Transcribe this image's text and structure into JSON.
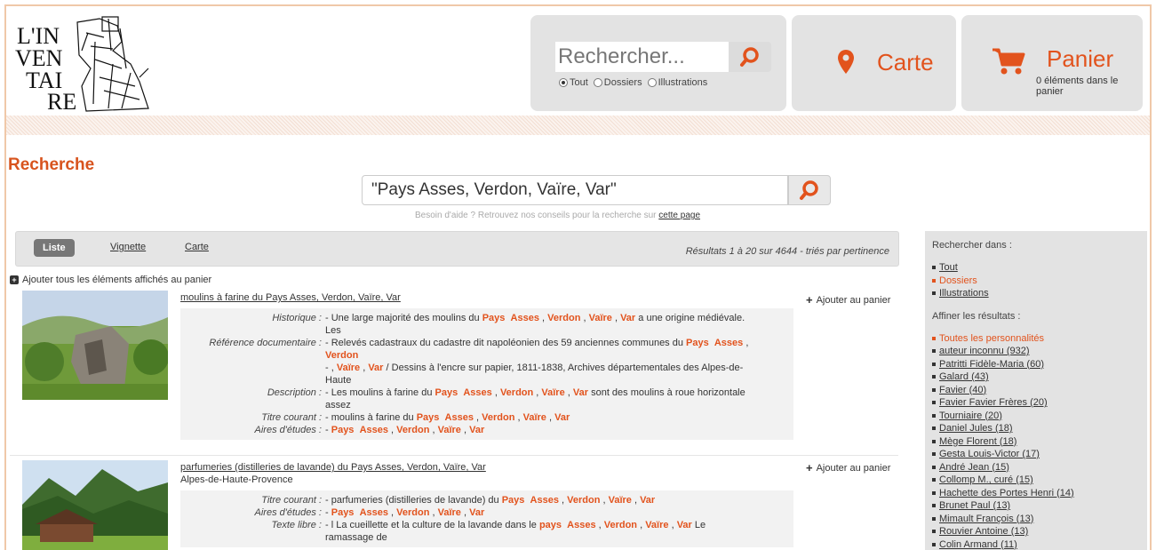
{
  "header": {
    "logo_text": "L'INVENTAIRE",
    "search_placeholder": "Rechercher...",
    "radio_options": [
      "Tout",
      "Dossiers",
      "Illustrations"
    ],
    "radio_selected": "Tout",
    "map_label": "Carte",
    "cart_label": "Panier",
    "cart_count": "0 éléments dans le panier"
  },
  "page_title": "Recherche",
  "main_search": {
    "value": "\"Pays Asses, Verdon, Vaïre, Var\"",
    "help_text": "Besoin d'aide ? Retrouvez nos conseils pour la recherche sur ",
    "help_link": "cette page"
  },
  "toolbar": {
    "tabs": [
      "Liste",
      "Vignette",
      "Carte"
    ],
    "results_text": "Résultats 1 à 20 sur 4644 - triés par pertinence"
  },
  "add_all_label": "Ajouter tous les éléments affichés au panier",
  "add_to_cart_label": "Ajouter au panier",
  "results": [
    {
      "title": "moulins à farine du Pays Asses, Verdon, Vaïre, Var",
      "subtitle": "",
      "fields": [
        {
          "label": "Historique :",
          "lines": [
            "- Une large majorité des moulins du ",
            "Pays",
            "Asses",
            "Verdon",
            "Vaïre",
            "Var",
            " a une origine médiévale.",
            "Les"
          ]
        },
        {
          "label": "Référence documentaire :",
          "lines": [
            "- Relevés cadastraux du cadastre dit napoléonien des 59 anciennes communes du ",
            "Pays",
            "Asses",
            "Verdon",
            "Vaïre",
            "Var",
            " / Dessins à l'encre sur papier, 1811-1838, Archives départementales des Alpes-de-",
            "Haute"
          ]
        },
        {
          "label": "Description :",
          "lines": [
            "- Les moulins à farine du ",
            "Pays",
            "Asses",
            "Verdon",
            "Vaïre",
            "Var",
            " sont des moulins à roue horizontale",
            "assez"
          ]
        },
        {
          "label": "Titre courant :",
          "lines": [
            "- moulins à farine du ",
            "Pays",
            "Asses",
            "Verdon",
            "Vaïre",
            "Var"
          ]
        },
        {
          "label": "Aires d'études :",
          "lines": [
            "- ",
            "Pays",
            "Asses",
            "Verdon",
            "Vaïre",
            "Var"
          ]
        }
      ]
    },
    {
      "title": "parfumeries (distilleries de lavande) du Pays Asses, Verdon, Vaïre, Var",
      "subtitle": "Alpes-de-Haute-Provence",
      "fields": [
        {
          "label": "Titre courant :",
          "lines": [
            "- parfumeries (distilleries de lavande) du ",
            "Pays",
            "Asses",
            "Verdon",
            "Vaïre",
            "Var"
          ]
        },
        {
          "label": "Aires d'études :",
          "lines": [
            "- ",
            "Pays",
            "Asses",
            "Verdon",
            "Vaïre",
            "Var"
          ]
        },
        {
          "label": "Texte libre :",
          "lines": [
            "- l La cueillette et la culture de la lavande dans le ",
            "pays",
            "Asses",
            "Verdon",
            "Vaïre",
            "Var",
            " Le",
            "ramassage de"
          ]
        }
      ]
    }
  ],
  "sidebar": {
    "search_in_title": "Rechercher dans :",
    "search_in": [
      {
        "label": "Tout",
        "selected": false
      },
      {
        "label": "Dossiers",
        "selected": true
      },
      {
        "label": "Illustrations",
        "selected": false
      }
    ],
    "refine_title": "Affiner les résultats :",
    "refine_all": "Toutes les personnalités",
    "personalities": [
      "auteur inconnu (932)",
      "Patritti Fidèle-Maria (60)",
      "Galard (43)",
      "Favier (40)",
      "Favier Favier Frères (20)",
      "Tourniaire (20)",
      "Daniel Jules (18)",
      "Mège Florent (18)",
      "Gesta Louis-Victor (17)",
      "André Jean (15)",
      "Collomp M., curé (15)",
      "Hachette des Portes Henri (14)",
      "Brunet Paul (13)",
      "Mimault François (13)",
      "Rouvier Antoine (13)",
      "Colin Armand (11)"
    ]
  },
  "colors": {
    "accent": "#e2531d",
    "panel": "#e3e3e3"
  }
}
